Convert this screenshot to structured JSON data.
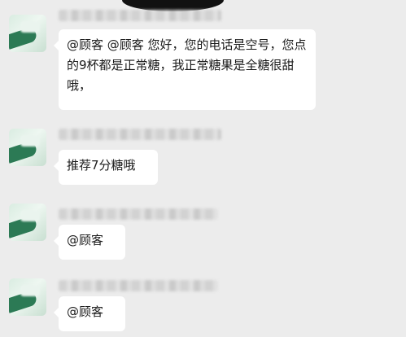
{
  "messages": [
    {
      "text": "@顾客 @顾客 您好，您的电话是空号，您点的9杯都是正常糖，我正常糖果是全糖很甜哦，"
    },
    {
      "text": "推荐7分糖哦"
    },
    {
      "text": "@顾客"
    },
    {
      "text": "@顾客"
    }
  ]
}
